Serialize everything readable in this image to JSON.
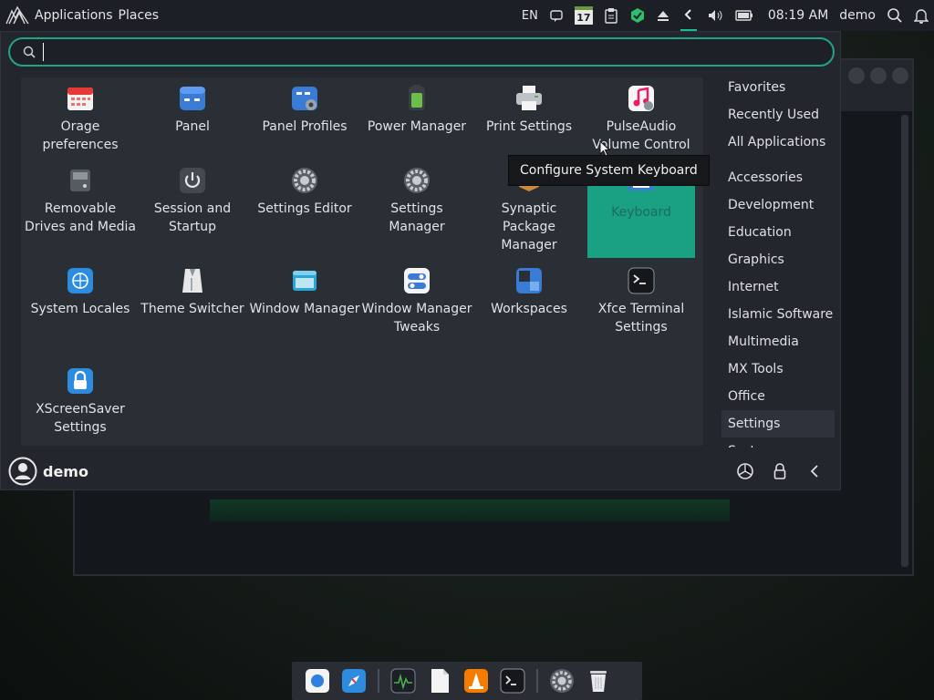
{
  "top_panel": {
    "applications_label": "Applications",
    "places_label": "Places",
    "keyboard_layout": "EN",
    "calendar_day": "17",
    "clock": "08:19 AM",
    "user": "demo"
  },
  "search": {
    "value": "",
    "placeholder": ""
  },
  "apps": [
    {
      "label": "Orage preferences",
      "icon": "calendar-icon"
    },
    {
      "label": "Panel",
      "icon": "panel-icon"
    },
    {
      "label": "Panel Profiles",
      "icon": "panel-profiles-icon"
    },
    {
      "label": "Power Manager",
      "icon": "battery-icon"
    },
    {
      "label": "Print Settings",
      "icon": "printer-icon"
    },
    {
      "label": "PulseAudio Volume Control",
      "icon": "music-note-icon"
    },
    {
      "label": "Removable Drives and Media",
      "icon": "drive-icon"
    },
    {
      "label": "Session and Startup",
      "icon": "power-icon"
    },
    {
      "label": "Settings Editor",
      "icon": "settings-gear-icon"
    },
    {
      "label": "Settings Manager",
      "icon": "settings-gear-icon"
    },
    {
      "label": "Synaptic Package Manager",
      "icon": "package-icon"
    },
    {
      "label": "Keyboard",
      "icon": "keyboard-icon"
    },
    {
      "label": "System Locales",
      "icon": "globe-icon"
    },
    {
      "label": "Theme Switcher",
      "icon": "shirt-icon"
    },
    {
      "label": "Window Manager",
      "icon": "window-icon"
    },
    {
      "label": "Window Manager Tweaks",
      "icon": "toggle-icon"
    },
    {
      "label": "Workspaces",
      "icon": "workspaces-icon"
    },
    {
      "label": "Xfce Terminal Settings",
      "icon": "terminal-icon"
    },
    {
      "label": "XScreenSaver Settings",
      "icon": "lock-icon"
    }
  ],
  "tooltip": "Configure System Keyboard",
  "categories": [
    "Favorites",
    "Recently Used",
    "All Applications",
    "Accessories",
    "Development",
    "Education",
    "Graphics",
    "Internet",
    "Islamic Software",
    "Multimedia",
    "MX Tools",
    "Office",
    "Settings",
    "System"
  ],
  "selected_category": "Settings",
  "footer": {
    "user": "demo"
  },
  "colors": {
    "accent": "#1aa083",
    "panel": "#1c1f25",
    "menu": "#23262d"
  }
}
